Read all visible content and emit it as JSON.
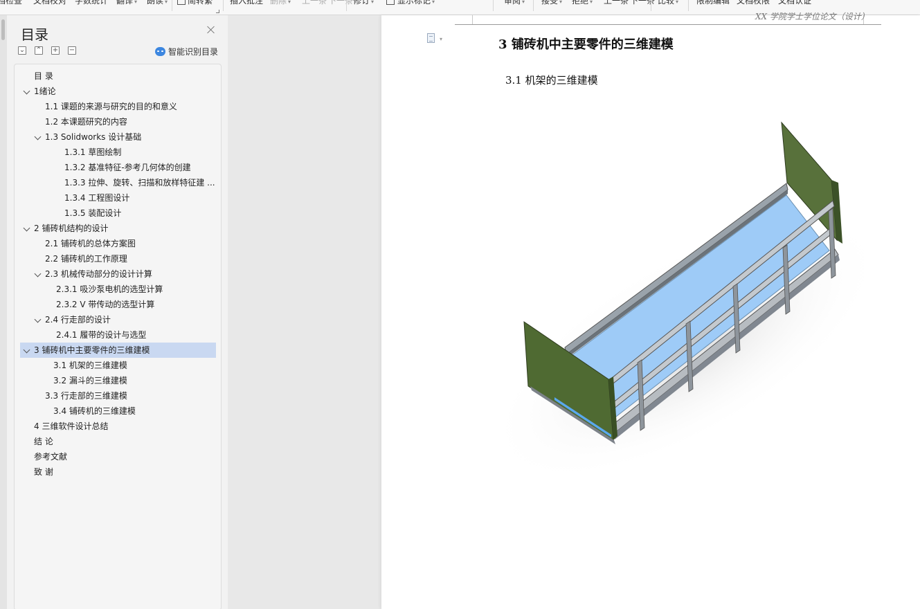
{
  "ribbon": {
    "items": [
      "档检查",
      "文档校对",
      "字数统计",
      "翻译",
      "朗读",
      "简转繁",
      "插入批注",
      "删除",
      "上一条",
      "下一条",
      "修订",
      "显示标记",
      "审阅",
      "接受",
      "拒绝",
      "上一条",
      "下一条",
      "比较",
      "限制编辑",
      "文档权限",
      "文档认证"
    ]
  },
  "toc": {
    "title": "目录",
    "smart_label": "智能识别目录",
    "items": [
      {
        "label": "目  录"
      },
      {
        "label": "1绪论"
      },
      {
        "label": "1.1 课题的来源与研究的目的和意义"
      },
      {
        "label": "1.2 本课题研究的内容"
      },
      {
        "label": "1.3 Solidworks 设计基础"
      },
      {
        "label": "1.3.1  草图绘制"
      },
      {
        "label": "1.3.2  基准特征-参考几何体的创建"
      },
      {
        "label": "1.3.3 拉伸、旋转、扫描和放样特征建 ..."
      },
      {
        "label": "1.3.4 工程图设计"
      },
      {
        "label": "1.3.5 装配设计"
      },
      {
        "label": "2  铺砖机结构的设计"
      },
      {
        "label": "2.1  铺砖机的总体方案图"
      },
      {
        "label": "2.2  铺砖机的工作原理"
      },
      {
        "label": "2.3  机械传动部分的设计计算"
      },
      {
        "label": "2.3.1 吸沙泵电机的选型计算"
      },
      {
        "label": "2.3.2 V 带传动的选型计算"
      },
      {
        "label": "2.4  行走部的设计"
      },
      {
        "label": "2.4.1  履带的设计与选型"
      },
      {
        "label": "3  铺砖机中主要零件的三维建模"
      },
      {
        "label": "3.1 机架的三维建模"
      },
      {
        "label": "3.2 漏斗的三维建模"
      },
      {
        "label": "3.3  行走部的三维建模"
      },
      {
        "label": "3.4 铺砖机的三维建模"
      },
      {
        "label": "4  三维软件设计总结"
      },
      {
        "label": "结    论"
      },
      {
        "label": "参考文献"
      },
      {
        "label": "致    谢"
      }
    ]
  },
  "document": {
    "header_text": "XX 学院学士学位论文（设计）",
    "heading1": "3  铺砖机中主要零件的三维建模",
    "heading2": "3.1 机架的三维建模"
  }
}
